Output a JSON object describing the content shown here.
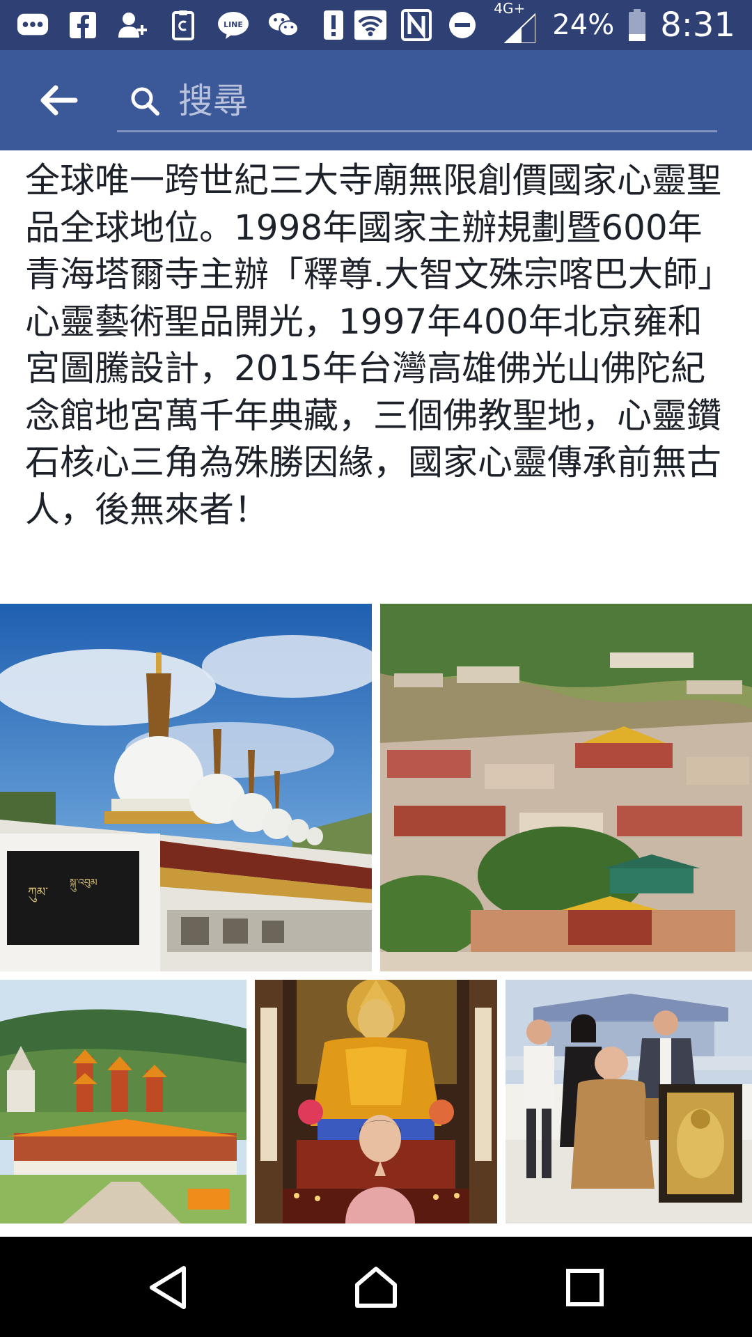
{
  "status_bar": {
    "battery_percent": "24%",
    "network_label": "4G+",
    "time": "8:31",
    "left_icons": [
      "messages-icon",
      "facebook-icon",
      "add-friend-icon",
      "clipboard-icon",
      "line-icon",
      "wechat-icon",
      "alert-icon"
    ],
    "right_icons": [
      "wifi-icon",
      "nfc-icon",
      "do-not-disturb-icon",
      "cell-signal-icon",
      "battery-icon"
    ]
  },
  "app_bar": {
    "search_placeholder": "搜尋",
    "accent_color": "#3b5998",
    "back_icon": "back-arrow-icon",
    "search_icon": "search-icon"
  },
  "post": {
    "text": "全球唯一跨世紀三大寺廟無限創價國家心靈聖品全球地位。1998年國家主辦規劃暨600年青海塔爾寺主辦「釋尊.大智文殊宗喀巴大師」心靈藝術聖品開光，1997年400年北京雍和宮圖騰設計，2015年台灣高雄佛光山佛陀紀念館地宮萬千年典藏，三個佛教聖地，心靈鑽石核心三角為殊勝因緣，國家心靈傳承前無古人，後無來者！",
    "photos": [
      "white-stupas-photo",
      "monastery-hillside-photo",
      "buddha-memorial-center-photo",
      "golden-buddha-shrine-photo",
      "group-with-monk-photo"
    ]
  },
  "nav_bar": {
    "back_icon": "nav-back-icon",
    "home_icon": "nav-home-icon",
    "recents_icon": "nav-recents-icon"
  }
}
